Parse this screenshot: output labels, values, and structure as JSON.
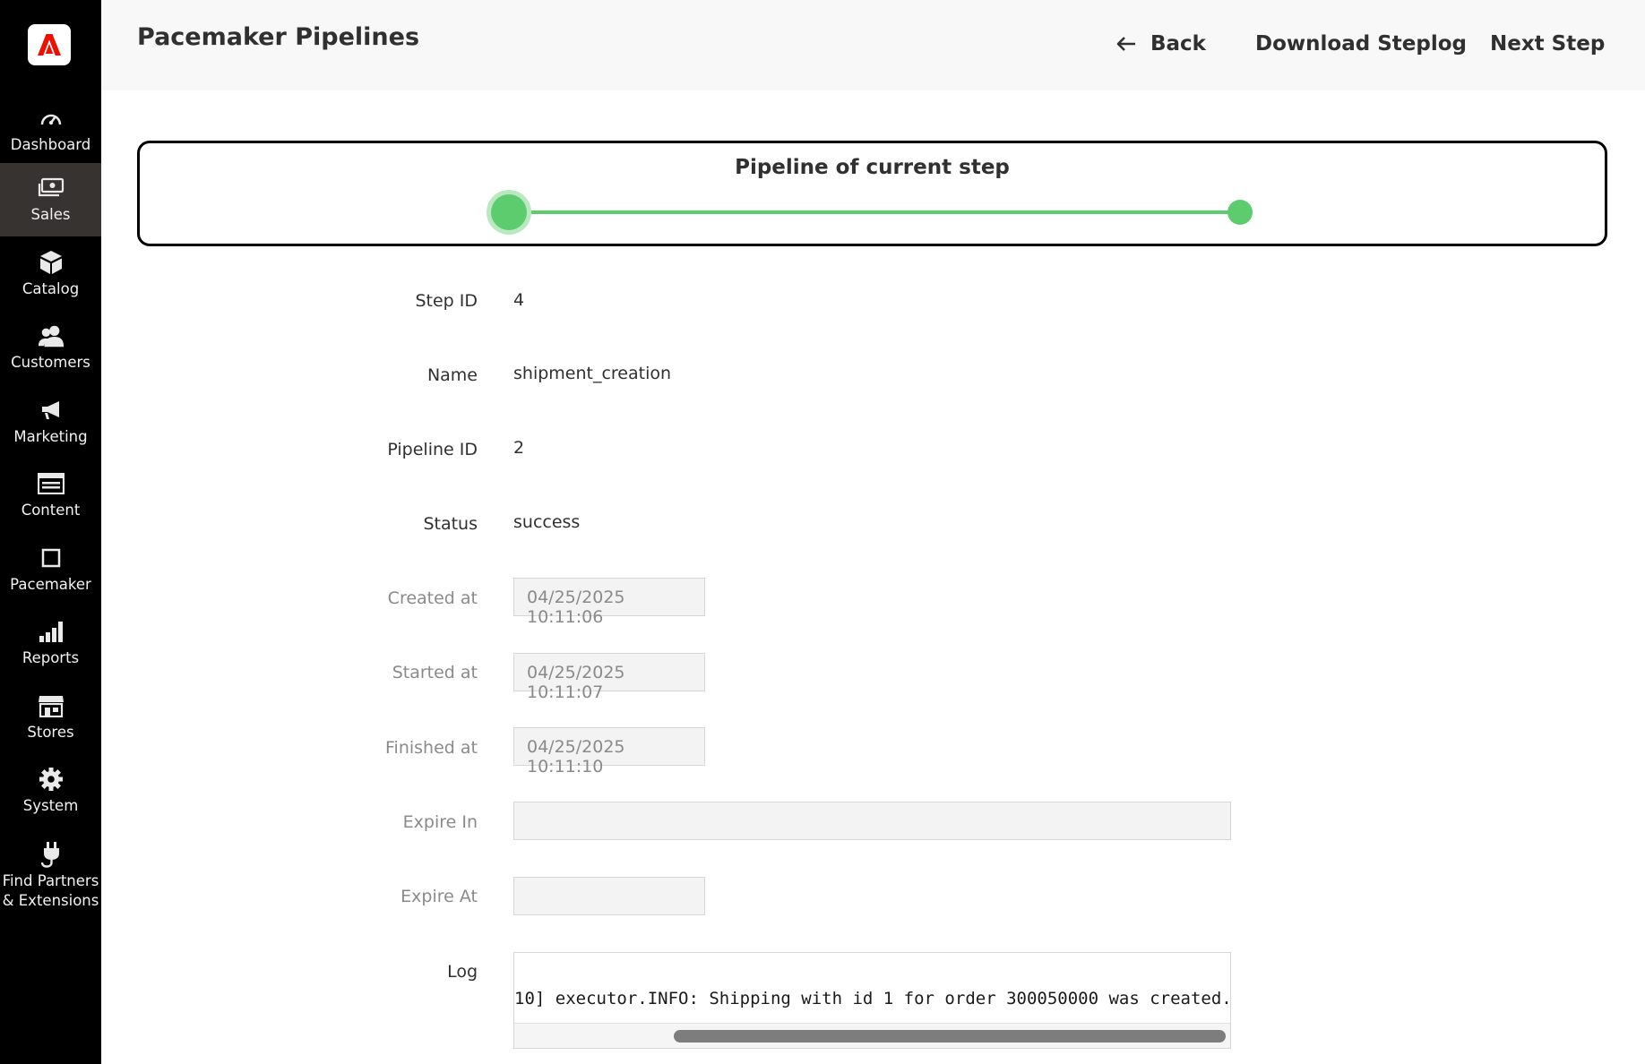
{
  "app": {
    "brand_color": "#eb1000",
    "logo_icon": "adobe-logo-icon"
  },
  "sidebar": {
    "items": [
      {
        "label": "Dashboard",
        "icon": "dashboard-gauge-icon"
      },
      {
        "label": "Sales",
        "icon": "sales-money-icon",
        "active": true
      },
      {
        "label": "Catalog",
        "icon": "catalog-box-icon"
      },
      {
        "label": "Customers",
        "icon": "customers-people-icon"
      },
      {
        "label": "Marketing",
        "icon": "marketing-megaphone-icon"
      },
      {
        "label": "Content",
        "icon": "content-layout-icon"
      },
      {
        "label": "Pacemaker",
        "icon": "pacemaker-square-icon"
      },
      {
        "label": "Reports",
        "icon": "reports-bars-icon"
      },
      {
        "label": "Stores",
        "icon": "stores-shop-icon"
      },
      {
        "label": "System",
        "icon": "system-gear-icon"
      },
      {
        "label": "Find Partners & Extensions",
        "icon": "partners-plug-icon"
      }
    ]
  },
  "header": {
    "title": "Pacemaker Pipelines",
    "back_label": "Back",
    "download_label": "Download Steplog",
    "next_label": "Next Step"
  },
  "pipeline": {
    "title": "Pipeline of current step",
    "color": "#5ccc6e",
    "steps_total": 2,
    "current_step": 1
  },
  "form": {
    "step_id": {
      "label": "Step ID",
      "value": "4"
    },
    "name": {
      "label": "Name",
      "value": "shipment_creation"
    },
    "pipeline_id": {
      "label": "Pipeline ID",
      "value": "2"
    },
    "status": {
      "label": "Status",
      "value": "success"
    },
    "created_at": {
      "label": "Created at",
      "value": "04/25/2025 10:11:06"
    },
    "started_at": {
      "label": "Started at",
      "value": "04/25/2025 10:11:07"
    },
    "finished_at": {
      "label": "Finished at",
      "value": "04/25/2025 10:11:10"
    },
    "expire_in": {
      "label": "Expire In",
      "value": ""
    },
    "expire_at": {
      "label": "Expire At",
      "value": ""
    },
    "log": {
      "label": "Log",
      "value": "10] executor.INFO: Shipping with id 1 for order 300050000 was created."
    }
  }
}
